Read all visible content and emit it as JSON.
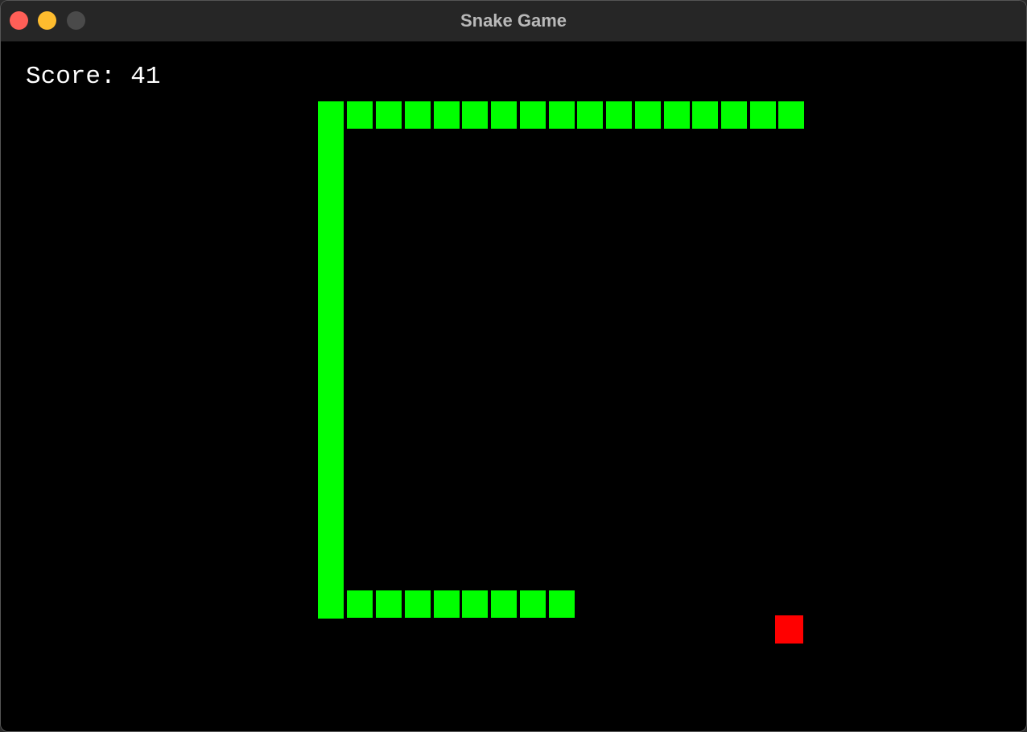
{
  "window": {
    "title": "Snake Game",
    "controls": {
      "close_color": "#ff5f57",
      "minimize_color": "#febc2e",
      "zoom_color": "#4a4a4a"
    }
  },
  "game": {
    "score_text": "Score: 41",
    "score_value": 41,
    "colors": {
      "background": "#000000",
      "snake": "#00ff00",
      "food": "#ff0000",
      "text": "#ffffff"
    }
  }
}
